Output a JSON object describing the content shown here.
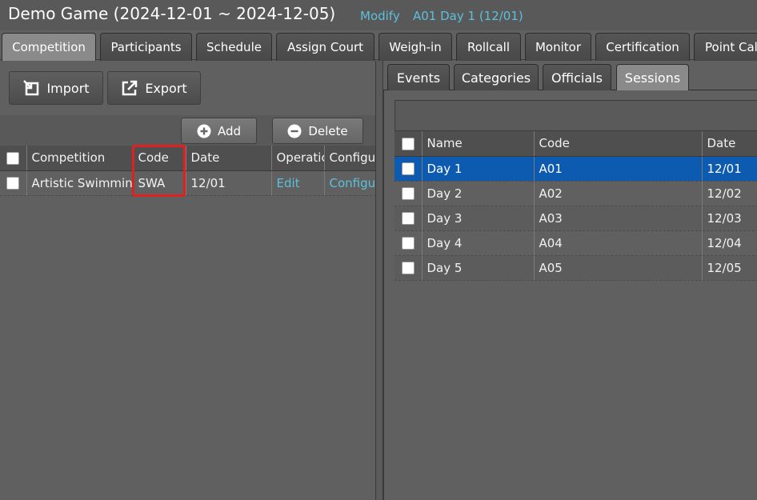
{
  "header": {
    "title": "Demo Game (2024-12-01 ~ 2024-12-05)",
    "modify_link": "Modify",
    "session_link": "A01 Day 1 (12/01)"
  },
  "main_tabs": [
    "Competition",
    "Participants",
    "Schedule",
    "Assign Court",
    "Weigh-in",
    "Rollcall",
    "Monitor",
    "Certification",
    "Point Cal"
  ],
  "active_main_tab": "Competition",
  "left": {
    "import_label": "Import",
    "export_label": "Export",
    "add_label": "Add",
    "delete_label": "Delete",
    "columns": [
      "Competition",
      "Code",
      "Date",
      "Operatic",
      "Configu"
    ],
    "rows": [
      {
        "competition": "Artistic Swimmin",
        "code": "SWA",
        "date": "12/01",
        "operation": "Edit",
        "config": "Configu"
      }
    ]
  },
  "right": {
    "sub_tabs": [
      "Events",
      "Categories",
      "Officials",
      "Sessions"
    ],
    "active_sub_tab": "Sessions",
    "columns": [
      "Name",
      "Code",
      "Date"
    ],
    "rows": [
      {
        "name": "Day 1",
        "code": "A01",
        "date": "12/01"
      },
      {
        "name": "Day 2",
        "code": "A02",
        "date": "12/02"
      },
      {
        "name": "Day 3",
        "code": "A03",
        "date": "12/03"
      },
      {
        "name": "Day 4",
        "code": "A04",
        "date": "12/04"
      },
      {
        "name": "Day 5",
        "code": "A05",
        "date": "12/05"
      }
    ],
    "selected_row": 0
  },
  "colors": {
    "link": "#5cc0dc",
    "selection": "#0c5bb0",
    "highlight_box": "#e02020"
  }
}
